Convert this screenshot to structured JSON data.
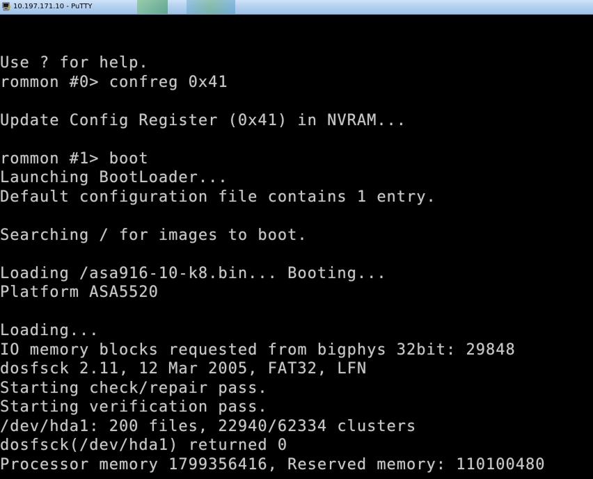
{
  "window": {
    "title": "10.197.171.10 - PuTTY",
    "icon": "putty-terminal-icon"
  },
  "terminal": {
    "lines": [
      "Use ? for help.",
      "rommon #0> confreg 0x41",
      "",
      "Update Config Register (0x41) in NVRAM...",
      "",
      "rommon #1> boot",
      "Launching BootLoader...",
      "Default configuration file contains 1 entry.",
      "",
      "Searching / for images to boot.",
      "",
      "Loading /asa916-10-k8.bin... Booting...",
      "Platform ASA5520",
      "",
      "Loading...",
      "IO memory blocks requested from bigphys 32bit: 29848",
      "dosfsck 2.11, 12 Mar 2005, FAT32, LFN",
      "Starting check/repair pass.",
      "Starting verification pass.",
      "/dev/hda1: 200 files, 22940/62334 clusters",
      "dosfsck(/dev/hda1) returned 0",
      "Processor memory 1799356416, Reserved memory: 110100480"
    ]
  }
}
